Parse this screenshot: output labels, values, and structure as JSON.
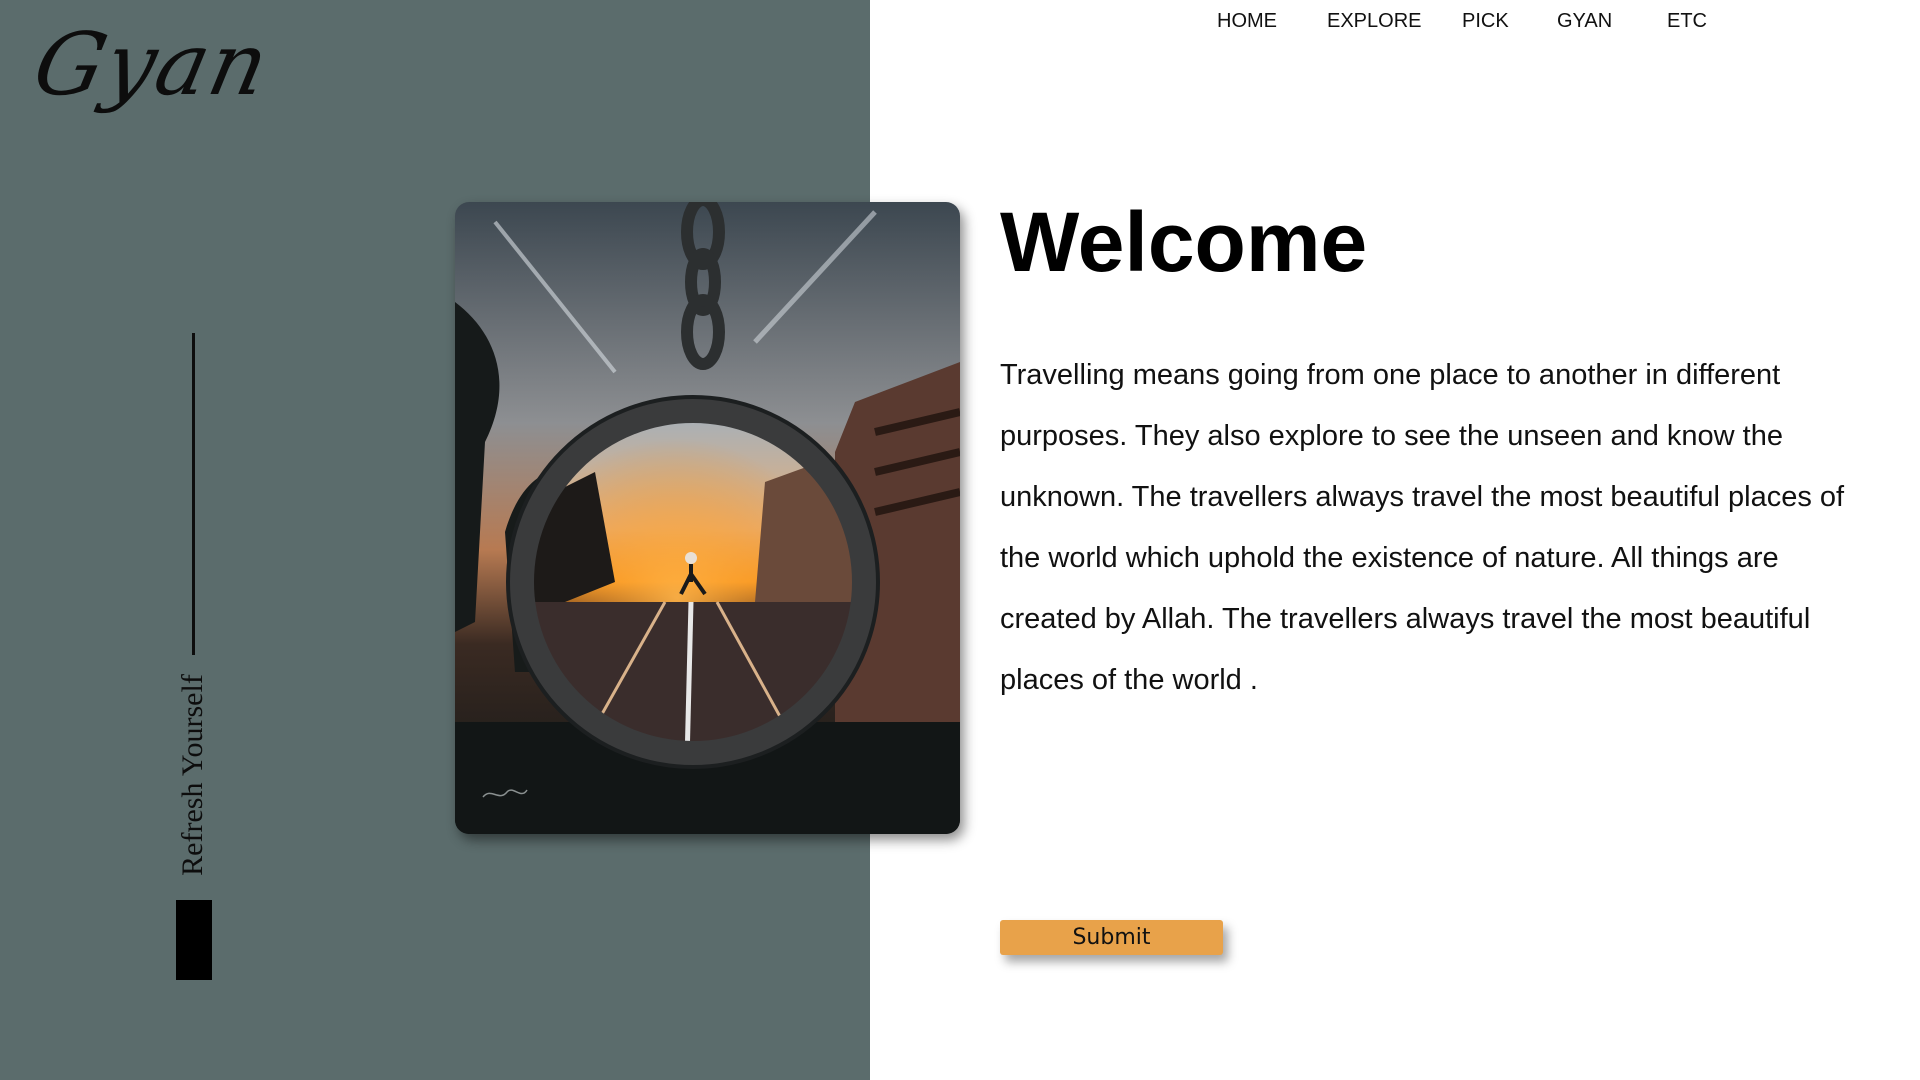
{
  "brand": {
    "logo_text": "Gyan",
    "tagline": "Refresh Yourself"
  },
  "nav": {
    "items": [
      {
        "label": "HOME"
      },
      {
        "label": "EXPLORE"
      },
      {
        "label": "PICK"
      },
      {
        "label": "GYAN"
      },
      {
        "label": "ETC"
      }
    ]
  },
  "main": {
    "heading": "Welcome",
    "paragraph": "Travelling means going from one place to another in different purposes. They also explore to see the unseen and know the unknown. The travellers always travel the most beautiful places of the world which uphold the existence of nature. All things are created by Allah. The travellers always travel the most beautiful places of the world .",
    "submit_label": "Submit"
  },
  "colors": {
    "left_panel": "#5b6c6c",
    "accent_button": "#e8a24a",
    "background": "#ffffff"
  }
}
